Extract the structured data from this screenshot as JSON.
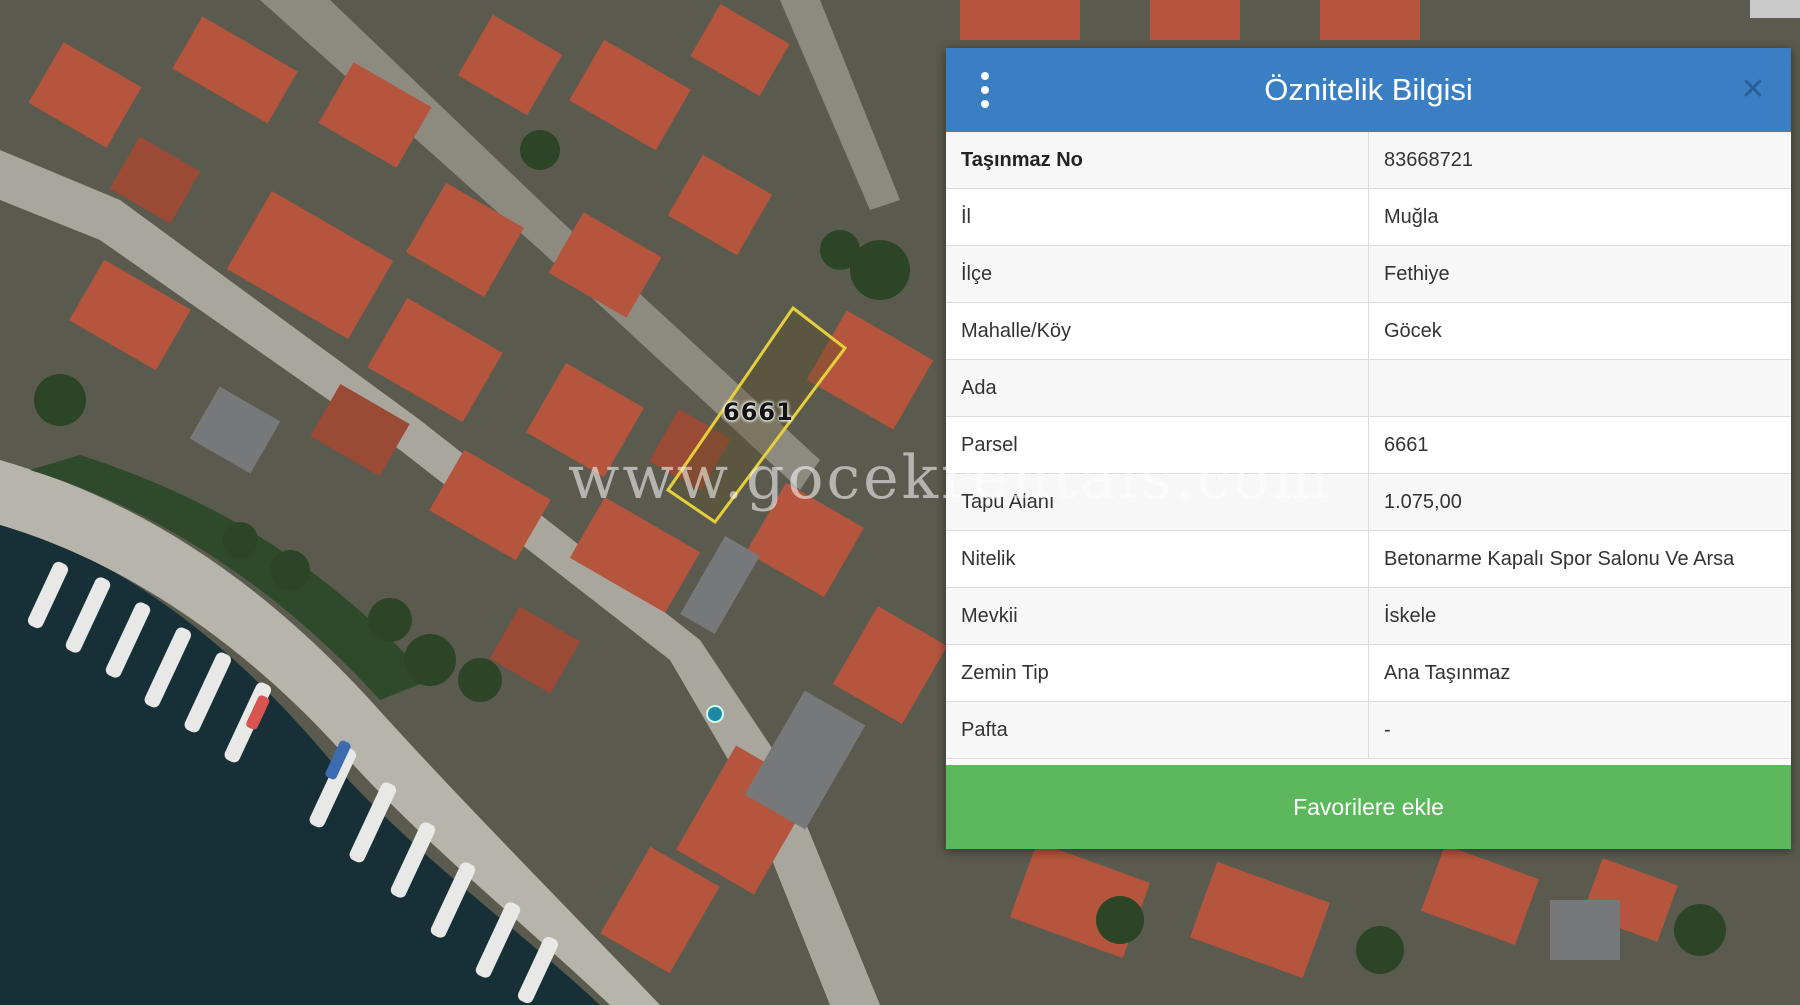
{
  "map": {
    "parcel_label": "6661",
    "watermark": "www.gocekrentals.com"
  },
  "panel": {
    "title": "Öznitelik Bilgisi",
    "close_symbol": "✕",
    "menu_icon": "vertical-dots-icon",
    "rows": [
      {
        "key": "Taşınmaz No",
        "value": "83668721"
      },
      {
        "key": "İl",
        "value": "Muğla"
      },
      {
        "key": "İlçe",
        "value": "Fethiye"
      },
      {
        "key": "Mahalle/Köy",
        "value": "Göcek"
      },
      {
        "key": "Ada",
        "value": ""
      },
      {
        "key": "Parsel",
        "value": "6661"
      },
      {
        "key": "Tapu Alanı",
        "value": "1.075,00"
      },
      {
        "key": "Nitelik",
        "value": "Betonarme Kapalı Spor Salonu Ve Arsa"
      },
      {
        "key": "Mevkii",
        "value": "İskele"
      },
      {
        "key": "Zemin Tip",
        "value": "Ana Taşınmaz"
      },
      {
        "key": "Pafta",
        "value": "-"
      }
    ],
    "favorite_button": "Favorilere ekle"
  },
  "colors": {
    "header": "#3a7fc4",
    "favorite_button": "#5cb85c",
    "parcel_outline": "#e6cf3c"
  }
}
